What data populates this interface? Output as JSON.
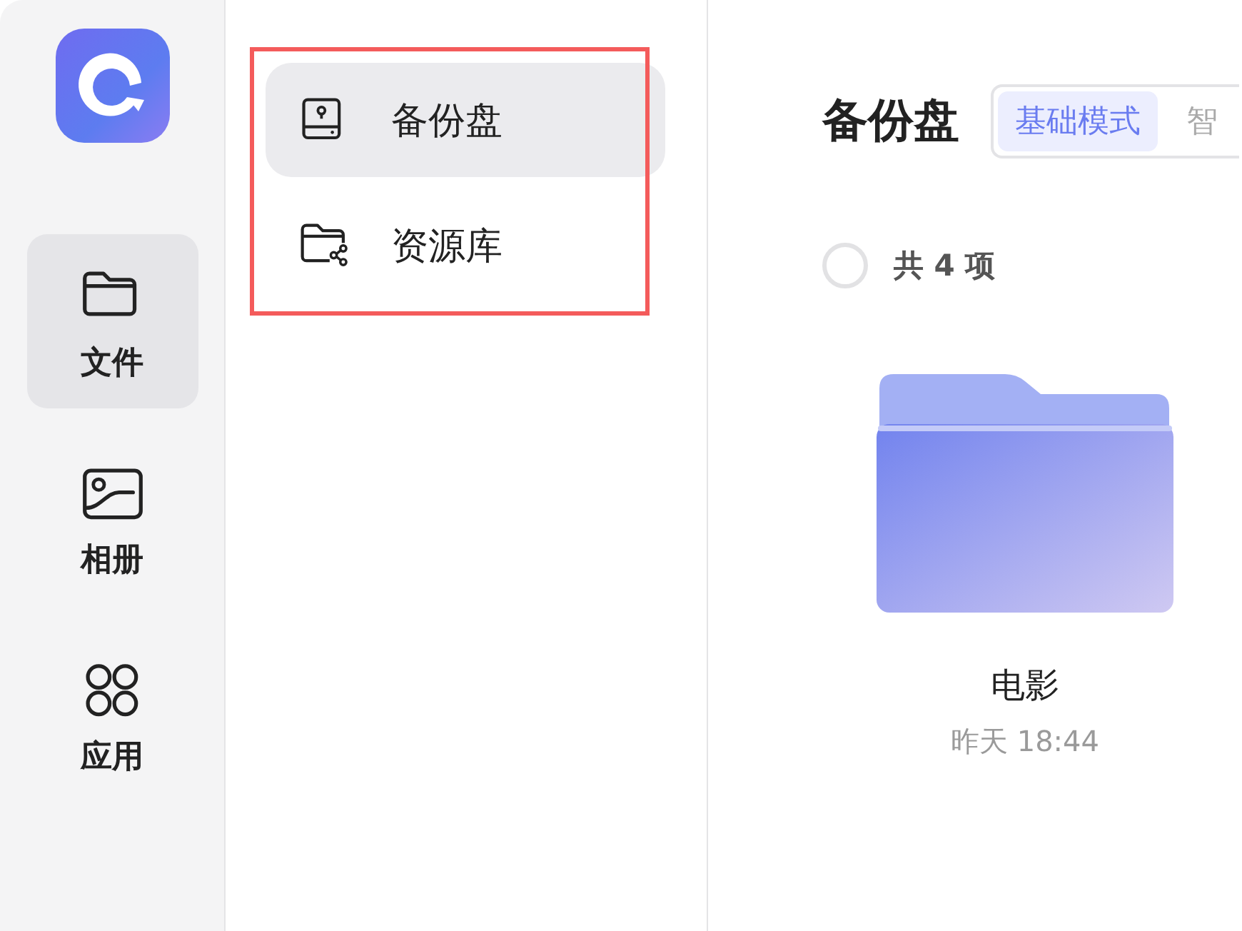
{
  "rail": {
    "items": [
      {
        "label": "文件",
        "kind": "folder",
        "selected": true
      },
      {
        "label": "相册",
        "kind": "photo",
        "selected": false
      },
      {
        "label": "应用",
        "kind": "apps",
        "selected": false
      }
    ]
  },
  "panel": {
    "items": [
      {
        "label": "备份盘",
        "kind": "drive",
        "selected": true
      },
      {
        "label": "资源库",
        "kind": "shared-folder",
        "selected": false
      }
    ]
  },
  "main": {
    "title": "备份盘",
    "modes": [
      {
        "label": "基础模式",
        "selected": true
      },
      {
        "label": "智",
        "selected": false
      }
    ],
    "select_all": {
      "checked": false
    },
    "count": "共 4 项",
    "items": [
      {
        "name": "电影",
        "time": "昨天 18:44"
      }
    ]
  }
}
